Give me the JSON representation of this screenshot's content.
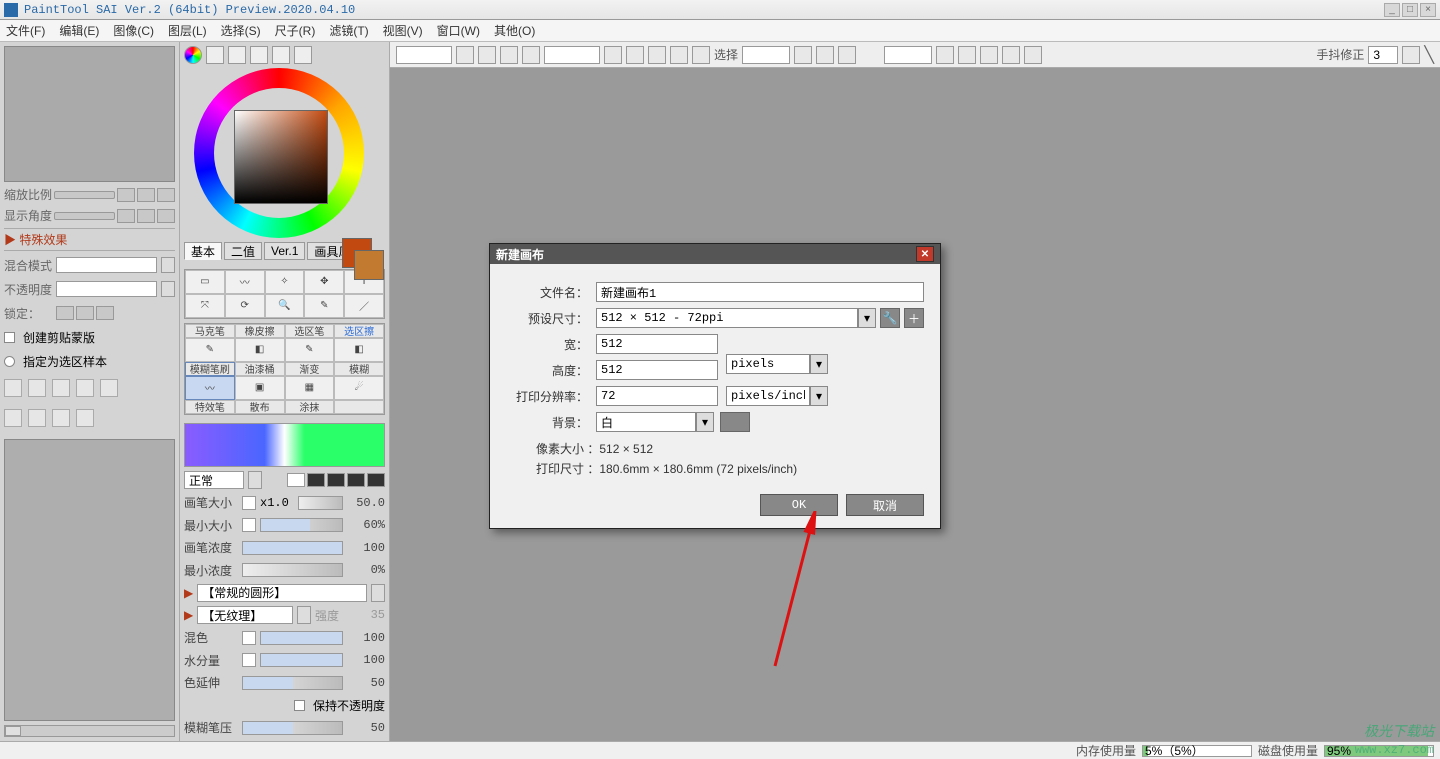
{
  "title": "PaintTool SAI Ver.2 (64bit) Preview.2020.04.10",
  "menu": [
    "文件(F)",
    "编辑(E)",
    "图像(C)",
    "图层(L)",
    "选择(S)",
    "尺子(R)",
    "滤镜(T)",
    "视图(V)",
    "窗口(W)",
    "其他(O)"
  ],
  "left_panel": {
    "zoom_label": "缩放比例",
    "angle_label": "显示角度",
    "effects_header": "▶ 特殊效果",
    "blend_label": "混合模式",
    "opacity_label": "不透明度",
    "lock_label": "锁定：",
    "clip_label": "创建剪贴蒙版",
    "sel_label": "指定为选区样本"
  },
  "mid_panel": {
    "tabs": [
      "基本",
      "二值",
      "Ver.1",
      "画具风"
    ],
    "tool_rows": [
      [
        "马克笔",
        "橡皮擦",
        "选区笔",
        "选区擦"
      ],
      [
        "模糊笔刷",
        "油漆桶",
        "渐变",
        "模糊"
      ],
      [
        "特效笔",
        "散布",
        "涂抹",
        ""
      ]
    ],
    "blend_value": "正常",
    "size_label": "画笔大小",
    "size_pre": "x1.0",
    "size_val": "50.0",
    "minsize_label": "最小大小",
    "minsize_val": "60%",
    "density_label": "画笔浓度",
    "density_val": "100",
    "mindensity_label": "最小浓度",
    "mindensity_val": "0%",
    "shape_label": "【常规的圆形】",
    "tex_label": "【无纹理】",
    "tex_pct": "35",
    "tex_dd": "强度",
    "mix_label": "混色",
    "mix_val": "100",
    "water_label": "水分量",
    "water_val": "100",
    "spread_label": "色延伸",
    "spread_val": "50",
    "keep_opacity": "保持不透明度",
    "blur_press_label": "模糊笔压",
    "blur_press_val": "50"
  },
  "top_toolbar": {
    "select_label": "选择",
    "stabilizer_label": "手抖修正",
    "stabilizer_value": "3"
  },
  "dialog": {
    "title": "新建画布",
    "filename_label": "文件名：",
    "filename_value": "新建画布1",
    "preset_label": "预设尺寸：",
    "preset_value": "512 × 512 - 72ppi",
    "width_label": "宽：",
    "width_value": "512",
    "height_label": "高度：",
    "height_value": "512",
    "unit_value": "pixels",
    "dpi_label": "打印分辨率：",
    "dpi_value": "72",
    "dpi_unit": "pixels/inch",
    "bg_label": "背景：",
    "bg_value": "白",
    "pixel_size_label": "像素大小 ：",
    "pixel_size_value": "512 × 512",
    "print_size_label": "打印尺寸 ：",
    "print_size_value": "180.6mm × 180.6mm (72 pixels/inch)",
    "ok": "OK",
    "cancel": "取消"
  },
  "statusbar": {
    "mem_label": "内存使用量",
    "mem_value": "5%（5%）",
    "disk_label": "磁盘使用量",
    "disk_value": "95%"
  },
  "watermark": "极光下载站",
  "watermark_url": "www.xz7.com"
}
